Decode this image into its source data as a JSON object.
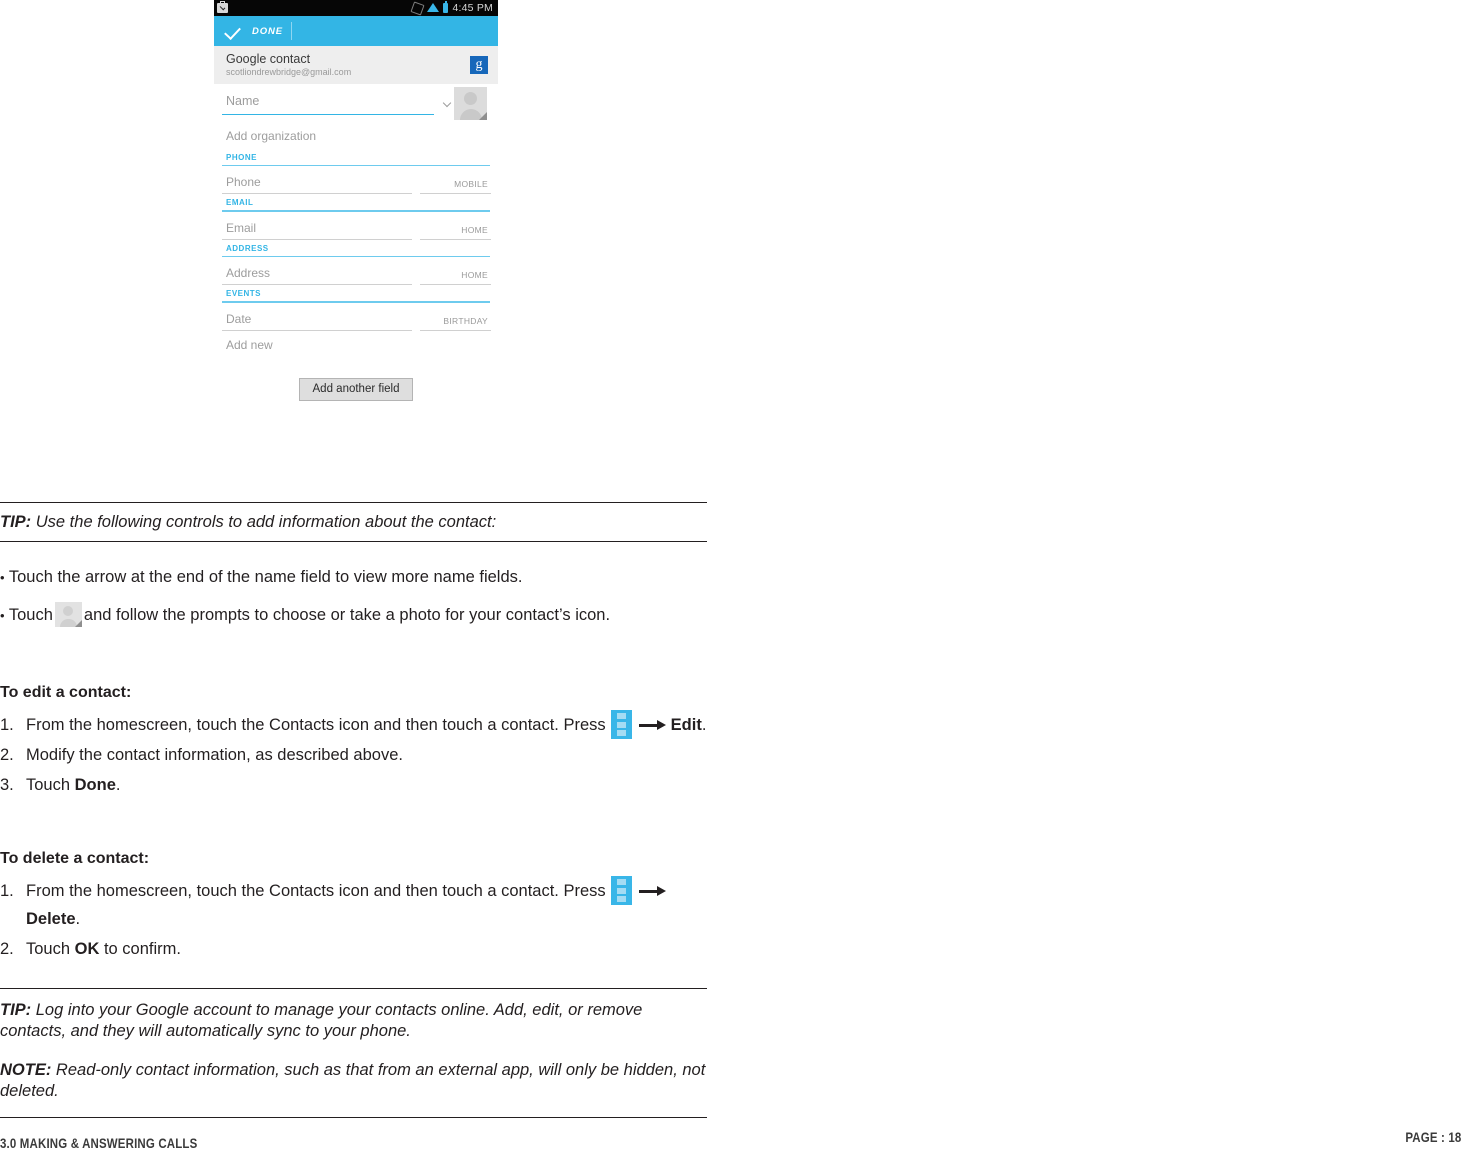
{
  "phone": {
    "status_bar": {
      "left_icon": "work-briefcase-check-icon",
      "icons": [
        "vibrate-icon",
        "wifi-icon",
        "battery-icon"
      ],
      "time": "4:45 PM"
    },
    "action_bar": {
      "done_label": "DONE",
      "check_icon": "check-icon"
    },
    "account": {
      "title": "Google contact",
      "email": "scotliondrewbridge@gmail.com",
      "badge": "g"
    },
    "fields": {
      "name_placeholder": "Name",
      "expand_icon": "chevron-down-icon",
      "avatar_icon": "contact-photo-icon",
      "add_organization": "Add organization",
      "sections": [
        {
          "label": "PHONE",
          "placeholder": "Phone",
          "type": "MOBILE"
        },
        {
          "label": "EMAIL",
          "placeholder": "Email",
          "type": "HOME"
        },
        {
          "label": "ADDRESS",
          "placeholder": "Address",
          "type": "HOME"
        },
        {
          "label": "EVENTS",
          "placeholder": "Date",
          "type": "BIRTHDAY"
        }
      ],
      "add_new": "Add new",
      "add_another_field": "Add another field"
    },
    "colors": {
      "accent": "#33b5e5",
      "status_bar_bg": "#060606",
      "account_bg": "#eeeeee",
      "google_badge_bg": "#1667ba"
    }
  },
  "doc": {
    "tip_top": {
      "label": "TIP:",
      "text": " Use the following controls to add information about the contact:"
    },
    "bullets": {
      "first": "Touch the arrow at the end of the name field to view more name fields.",
      "second_pre": "Touch",
      "second_post": "and follow the prompts to choose or take a photo for your contact’s icon."
    },
    "edit_section": {
      "heading": "To edit a contact:",
      "steps": [
        {
          "num": "1.",
          "text_pre": "From the homescreen, touch the Contacts icon and then touch a contact. Press",
          "bold": "Edit",
          "text_post": "."
        },
        {
          "num": "2.",
          "text_pre": "Modify the contact information, as described above.",
          "bold": "",
          "text_post": ""
        },
        {
          "num": "3.",
          "text_pre": "Touch",
          "bold": "Done",
          "text_post": "."
        }
      ]
    },
    "delete_section": {
      "heading": "To delete a contact:",
      "steps": [
        {
          "num": "1.",
          "text_pre": "From the homescreen, touch the Contacts icon and then touch a contact. Press",
          "bold": "Delete",
          "text_post": "."
        },
        {
          "num": "2.",
          "text_pre": "Touch",
          "bold": "OK",
          "text_post": " to confirm."
        }
      ]
    },
    "tip_bottom": {
      "label": "TIP:",
      "text": " Log into your Google account to manage your contacts online. Add, edit, or remove contacts, and they will automatically sync to your phone."
    },
    "note_bottom": {
      "label": "NOTE:",
      "text": " Read-only contact information, such as that from an external app, will only be hidden, not deleted."
    },
    "footer": {
      "section": "3.0 MAKING & ANSWERING CALLS",
      "page": "PAGE : 18"
    }
  }
}
